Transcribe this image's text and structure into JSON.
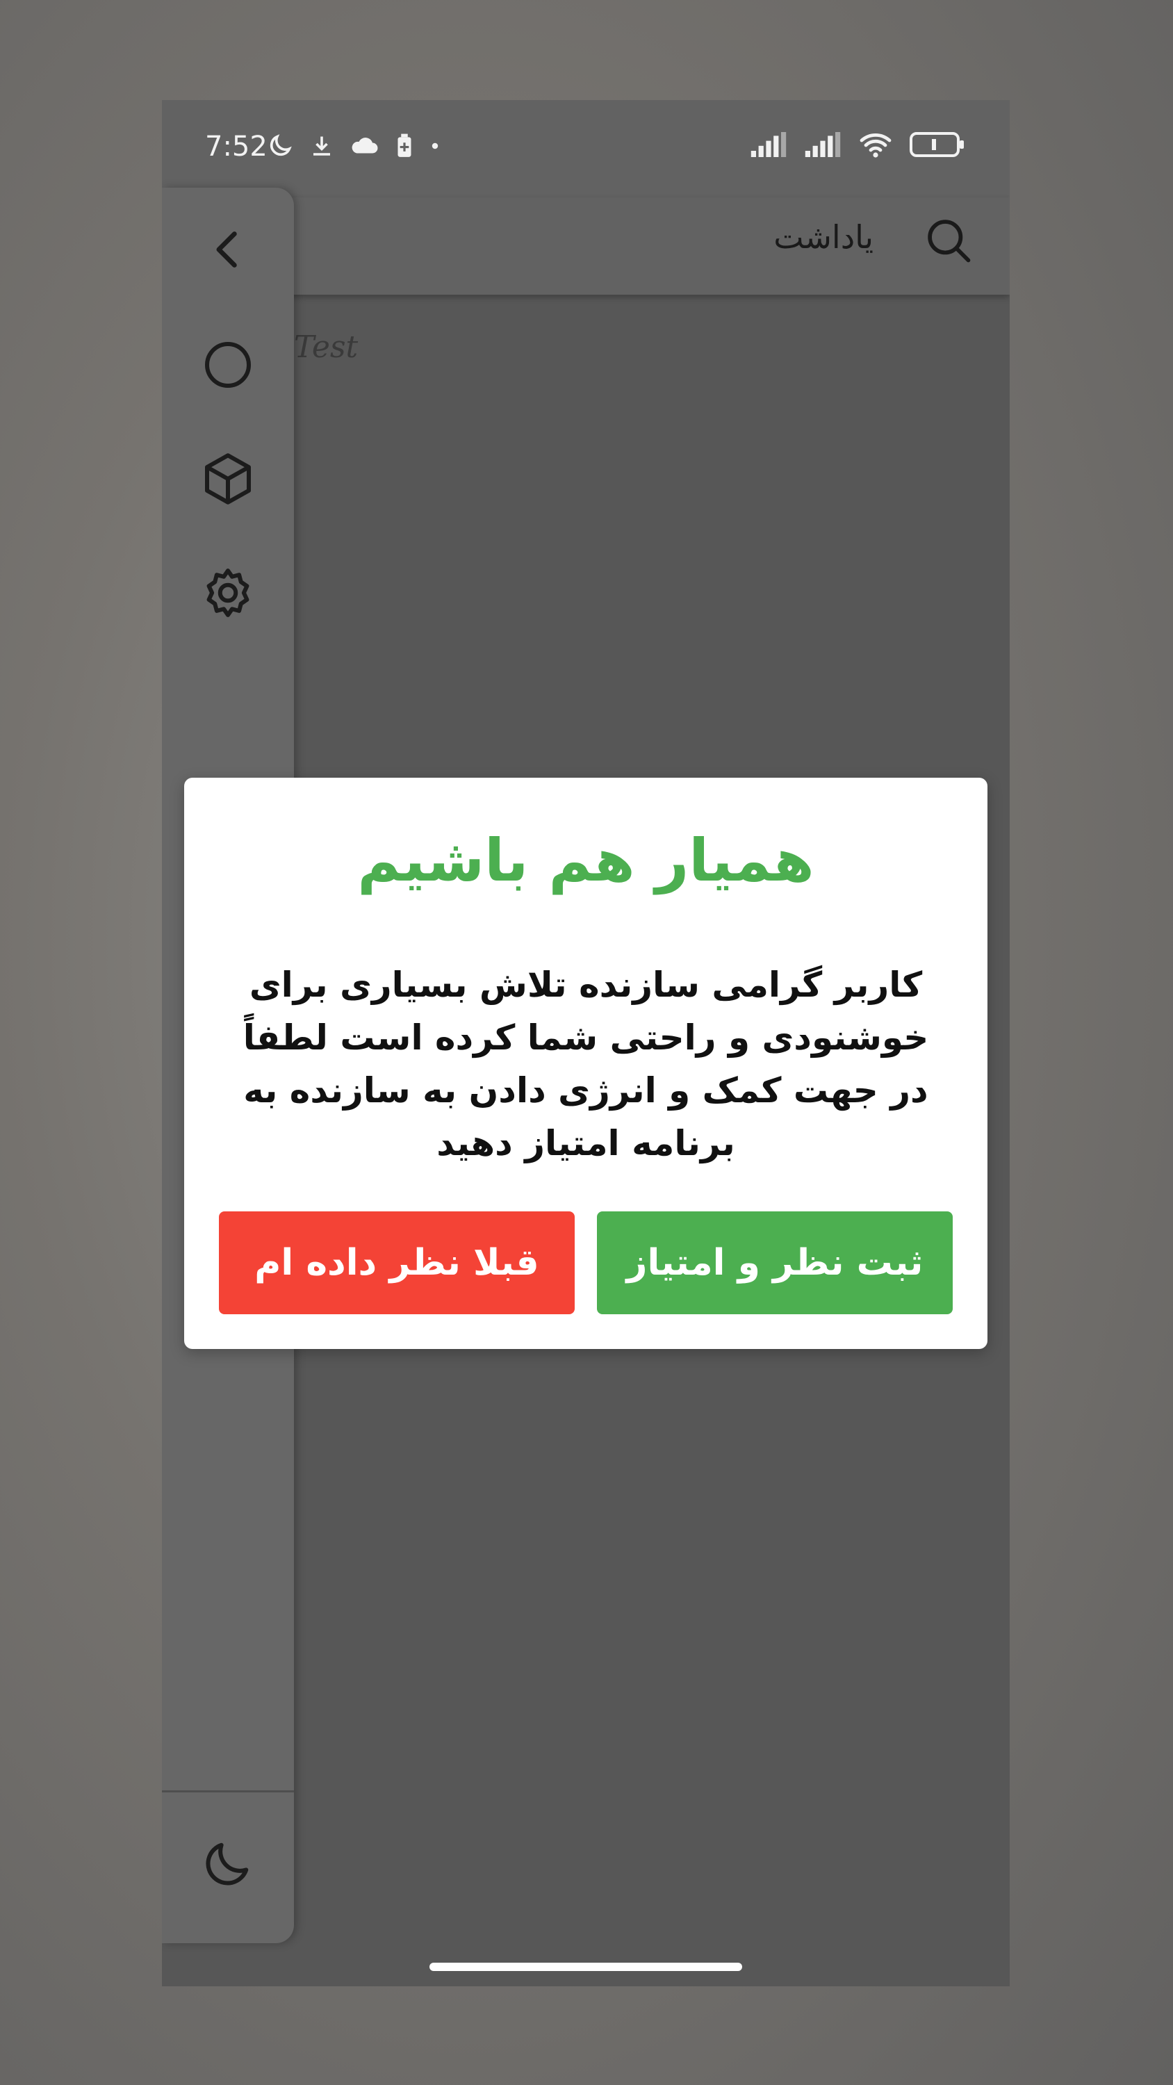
{
  "statusbar": {
    "time": "7:52",
    "left_icons": [
      "moon-icon",
      "download-icon",
      "cloud-icon",
      "battery-saver-icon",
      "dot-icon"
    ],
    "right_icons": [
      "signal-icon",
      "signal-icon",
      "wifi-icon",
      "battery-icon"
    ]
  },
  "appbar": {
    "title": "یاداشت",
    "search_icon": "search-icon"
  },
  "content": {
    "note_text": "Test"
  },
  "drawer": {
    "items": [
      "chevron-left-icon",
      "circle-icon",
      "cube-icon",
      "gear-icon"
    ],
    "bottom_item": "moon-icon"
  },
  "dialog": {
    "title": "همیار هم باشیم",
    "body": "کاربر گرامی سازنده تلاش بسیاری برای خوشنودی و راحتی شما کرده است لطفاً در جهت کمک و انرژی دادن به سازنده به برنامه امتیاز دهید",
    "rate_button": "ثبت نظر و امتیاز",
    "already_button": "قبلا نظر داده ام",
    "colors": {
      "accent": "#4caf50",
      "danger": "#f44336"
    }
  }
}
